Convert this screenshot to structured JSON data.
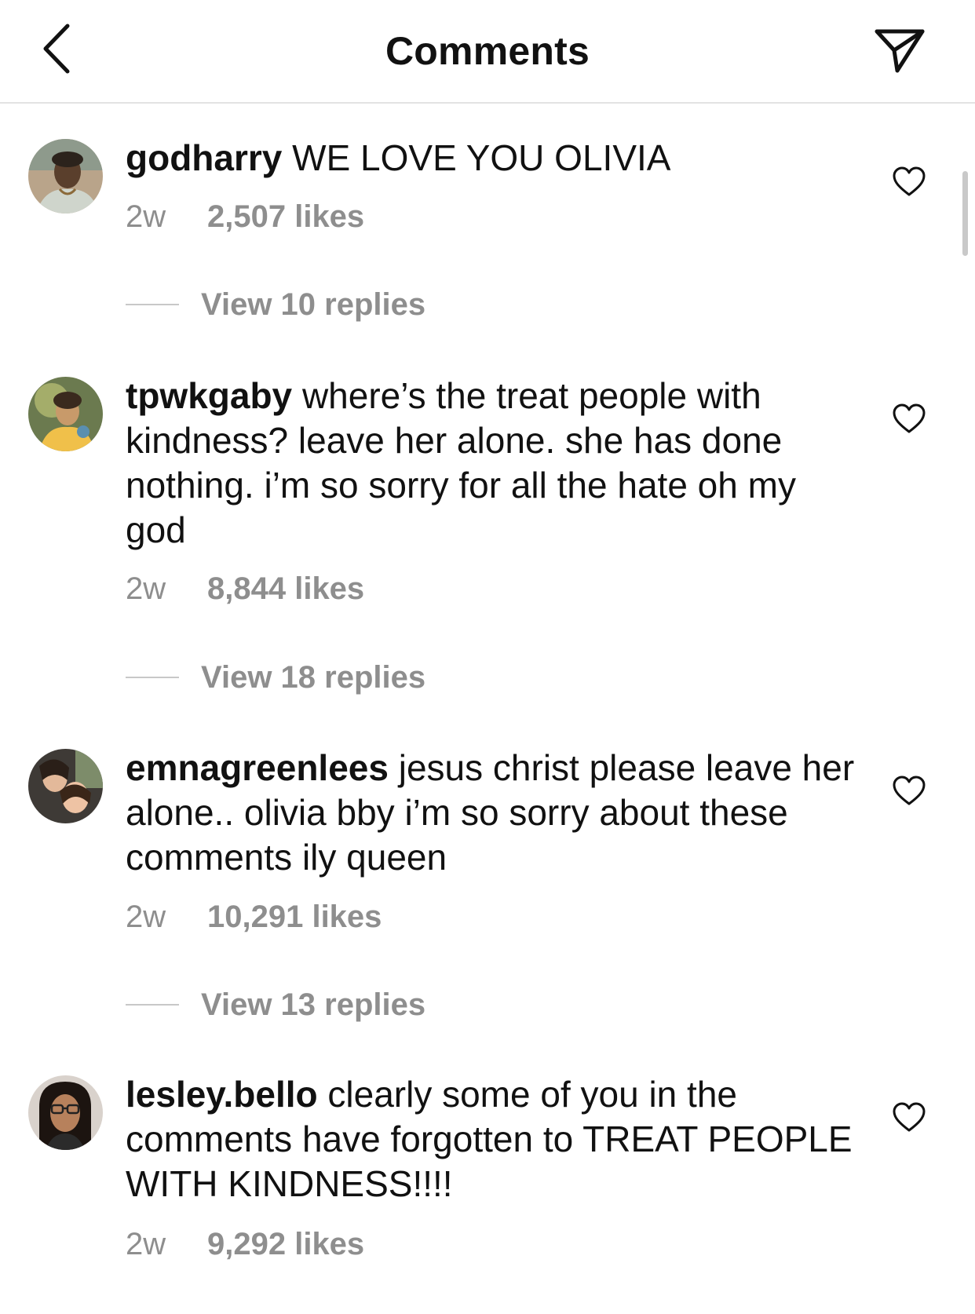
{
  "header": {
    "title": "Comments",
    "back_icon": "chevron-left-icon",
    "share_icon": "paper-plane-icon"
  },
  "colors": {
    "text": "#111111",
    "muted": "#8e8e8e",
    "divider": "#e3e3e3"
  },
  "comments": [
    {
      "username": "godharry",
      "text": "WE LOVE YOU OLIVIA",
      "time": "2w",
      "likes": "2,507 likes",
      "replies": "View 10 replies"
    },
    {
      "username": "tpwkgaby",
      "text": "where’s the treat people with kindness? leave her alone. she has done nothing. i’m so sorry for all the hate oh my god",
      "time": "2w",
      "likes": "8,844 likes",
      "replies": "View 18 replies"
    },
    {
      "username": "emnagreenlees",
      "text": "jesus christ please leave her alone.. olivia bby i’m so sorry about these comments ily queen",
      "time": "2w",
      "likes": "10,291 likes",
      "replies": "View 13 replies"
    },
    {
      "username": "lesley.bello",
      "text": "clearly some of you in the comments have forgotten to TREAT PEOPLE WITH KINDNESS!!!!",
      "time": "2w",
      "likes": "9,292 likes"
    }
  ]
}
